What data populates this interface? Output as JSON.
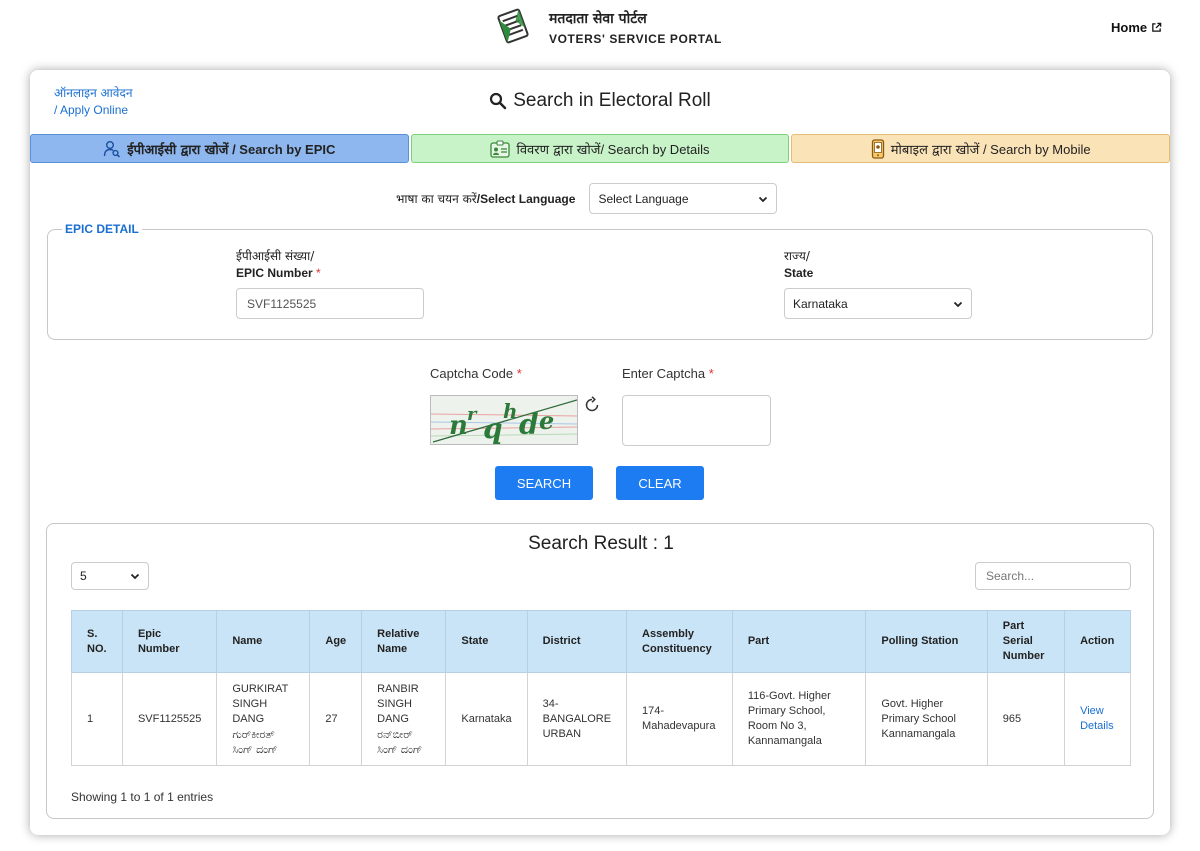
{
  "header": {
    "portal_name_hi": "मतदाता सेवा पोर्टल",
    "portal_name_en": "VOTERS' SERVICE PORTAL",
    "home_label": "Home"
  },
  "apply_online": {
    "line1": "ऑनलाइन आवेदन",
    "line2": "/ Apply Online"
  },
  "page_title": "Search in Electoral Roll",
  "tabs": [
    {
      "hi": "ईपीआईसी द्वारा खोजें",
      "en": " / Search by EPIC",
      "icon": "user-search-icon"
    },
    {
      "hi": "विवरण द्वारा खोजें",
      "en": "/ Search by Details",
      "icon": "id-card-icon"
    },
    {
      "hi": "मोबाइल द्वारा खोजें",
      "en": " / Search by Mobile",
      "icon": "mobile-icon"
    }
  ],
  "language": {
    "label_hi": "भाषा का चयन करें",
    "label_en": "/Select Language",
    "value": "Select Language"
  },
  "epic_detail": {
    "legend": "EPIC DETAIL",
    "epic_label_hi": "ईपीआईसी संख्या/",
    "epic_label_en": "EPIC Number",
    "epic_value": "SVF1125525",
    "state_label_hi": "राज्य/",
    "state_label_en": "State",
    "state_value": "Karnataka"
  },
  "captcha": {
    "code_label": "Captcha Code",
    "enter_label": "Enter Captcha",
    "required_mark": "*",
    "image_text": [
      "n",
      "r",
      "q",
      "h",
      "d",
      "e"
    ]
  },
  "buttons": {
    "search": "SEARCH",
    "clear": "CLEAR"
  },
  "result": {
    "title": "Search Result : 1",
    "page_size": "5",
    "search_placeholder": "Search...",
    "columns": [
      "S. NO.",
      "Epic Number",
      "Name",
      "Age",
      "Relative Name",
      "State",
      "District",
      "Assembly Constituency",
      "Part",
      "Polling Station",
      "Part Serial Number",
      "Action"
    ],
    "rows": [
      {
        "sno": "1",
        "epic": "SVF1125525",
        "name_en": "GURKIRAT SINGH DANG",
        "name_kn": "ಗುರ್‌ಕೀರತ್ ಸಿಂಗ್ ದಂಗ್",
        "age": "27",
        "relative_en": "RANBIR SINGH DANG",
        "relative_kn": "ರನ್‌ಬೀರ್ ಸಿಂಗ್ ದಂಗ್",
        "state": "Karnataka",
        "district": "34-BANGALORE URBAN",
        "assembly": "174-Mahadevapura",
        "part": "116-Govt. Higher Primary School, Room No 3, Kannamangala",
        "polling_station": "Govt. Higher Primary School Kannamangala",
        "serial": "965",
        "action": "View Details"
      }
    ],
    "showing": "Showing 1 to 1 of 1 entries"
  }
}
